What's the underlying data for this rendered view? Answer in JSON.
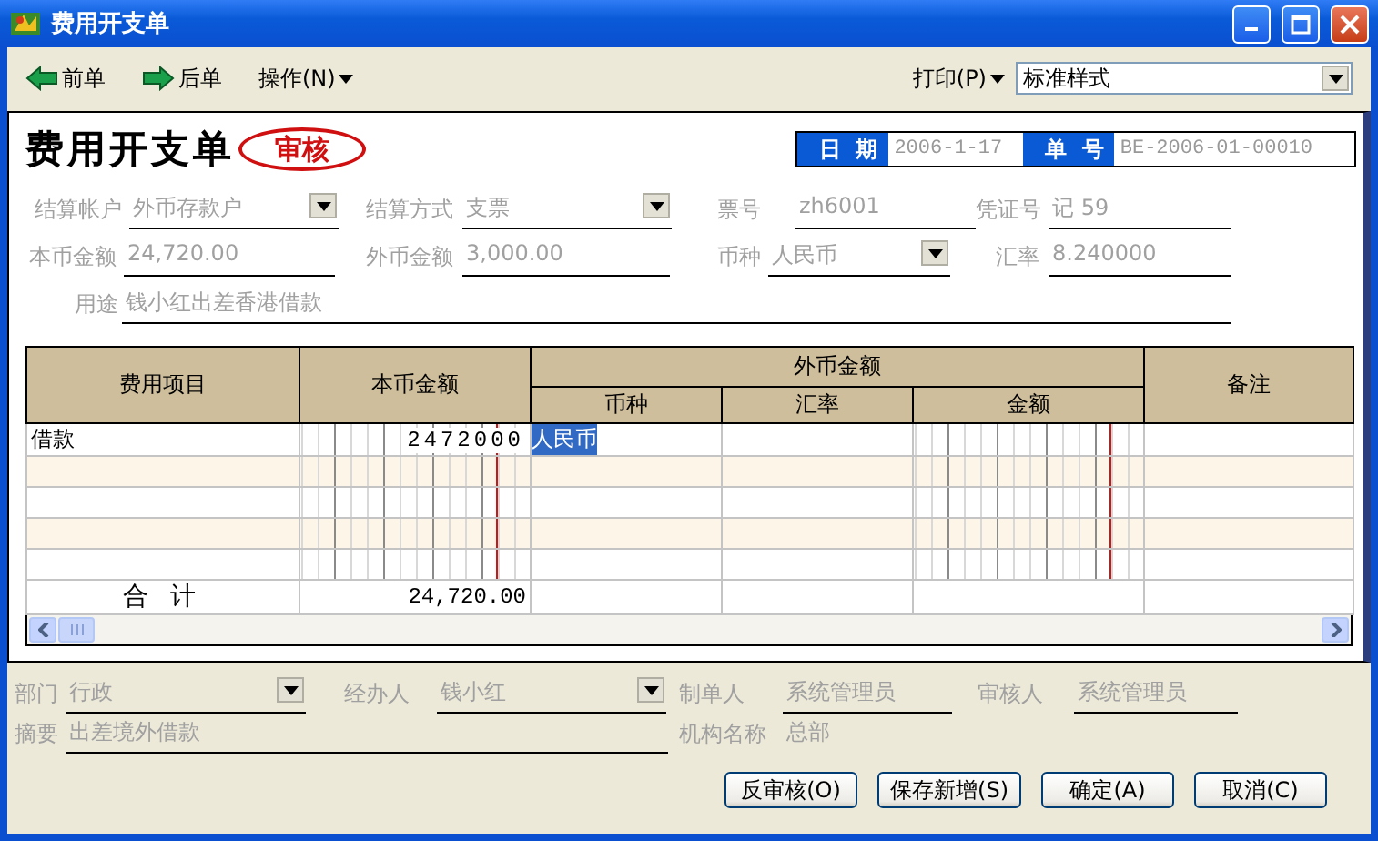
{
  "window": {
    "title": "费用开支单"
  },
  "toolbar": {
    "items": [
      {
        "kind": "prev",
        "label": "前单"
      },
      {
        "kind": "next",
        "label": "后单"
      },
      {
        "kind": "menu",
        "label": "操作(N)"
      }
    ],
    "print": {
      "label": "打印(P)",
      "style": "标准样式"
    }
  },
  "form": {
    "title": "费用开支单",
    "stamp": "审核",
    "date": {
      "label": "日 期",
      "value": "2006-1-17"
    },
    "number": {
      "label": "单 号",
      "value": "BE-2006-01-00010"
    },
    "rows": [
      [
        {
          "kind": "select",
          "label": "结算帐户",
          "value": "外币存款户",
          "disabled": true
        },
        {
          "kind": "select",
          "label": "结算方式",
          "value": "支票",
          "disabled": true
        },
        {
          "kind": "text",
          "label": "票号",
          "value": "zh6001",
          "disabled": true
        },
        {
          "kind": "text",
          "label": "凭证号",
          "value": "记 59",
          "disabled": true
        }
      ],
      [
        {
          "kind": "text",
          "label": "本币金额",
          "value": "24,720.00",
          "disabled": true
        },
        {
          "kind": "text",
          "label": "外币金额",
          "value": "3,000.00",
          "disabled": true
        },
        {
          "kind": "select",
          "label": "币种",
          "value": "人民币",
          "disabled": true
        },
        {
          "kind": "text",
          "label": "汇率",
          "value": "8.240000",
          "disabled": true
        }
      ],
      [
        {
          "kind": "text",
          "label": "用途",
          "value": "钱小红出差香港借款",
          "disabled": true
        }
      ]
    ]
  },
  "table": {
    "columns": [
      {
        "label": "费用项目"
      },
      {
        "label": "本币金额"
      },
      {
        "label": "外币金额",
        "children": [
          {
            "label": "币种"
          },
          {
            "label": "汇率"
          },
          {
            "label": "金额"
          }
        ]
      },
      {
        "label": "备注"
      }
    ],
    "rows": [
      {
        "item": "借款",
        "local_amount": "2472000",
        "currency": "人民币",
        "selected": true
      },
      {
        "selected": false
      },
      {
        "selected": false
      },
      {
        "selected": false
      },
      {
        "selected": false
      }
    ],
    "total": {
      "label": "合 计",
      "local_amount": "24,720.00"
    }
  },
  "footer": {
    "fields": [
      {
        "kind": "select",
        "label": "部门",
        "value": "行政",
        "disabled": true
      },
      {
        "kind": "select",
        "label": "经办人",
        "value": "钱小红",
        "disabled": true
      },
      {
        "kind": "text",
        "label": "制单人",
        "value": "系统管理员",
        "disabled": true
      },
      {
        "kind": "text",
        "label": "审核人",
        "value": "系统管理员",
        "disabled": true
      },
      {
        "kind": "text",
        "label": "摘要",
        "value": "出差境外借款",
        "disabled": true
      },
      {
        "kind": "plain",
        "label": "机构名称",
        "value": "总部",
        "disabled": true
      }
    ],
    "buttons": [
      "反审核(O)",
      "保存新增(S)",
      "确定(A)",
      "取消(C)"
    ]
  }
}
